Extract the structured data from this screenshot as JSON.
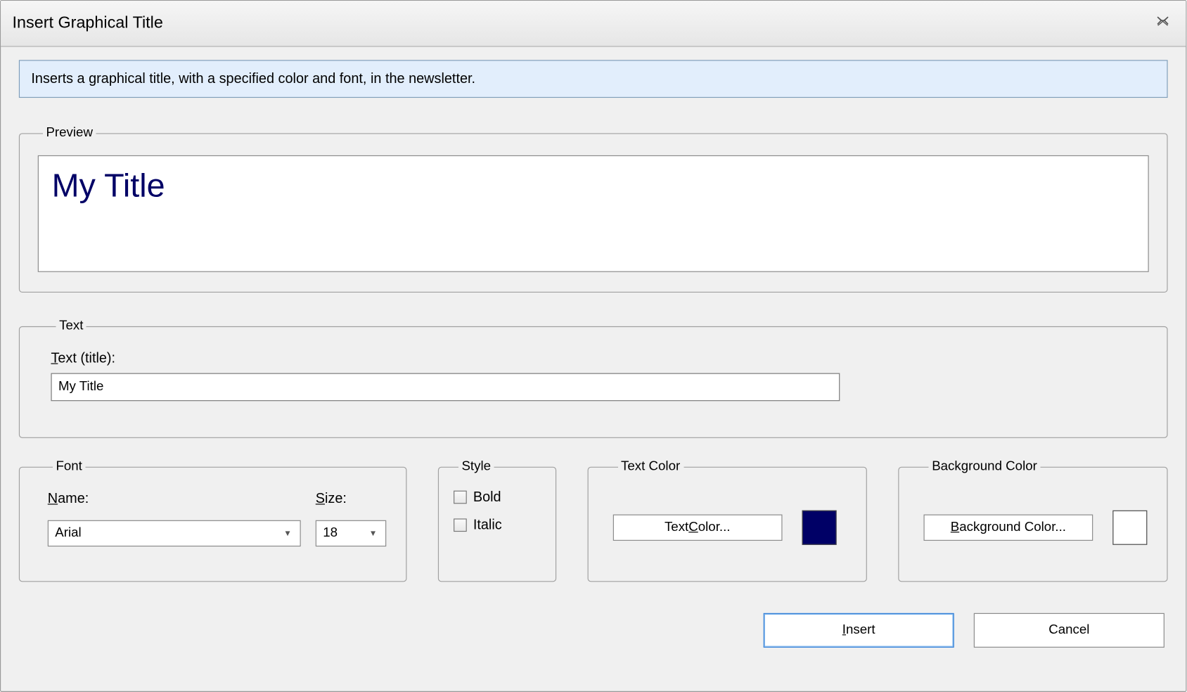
{
  "window": {
    "title": "Insert Graphical Title"
  },
  "description": "Inserts a graphical title, with a specified color and font, in the newsletter.",
  "groups": {
    "preview": "Preview",
    "text": "Text",
    "font": "Font",
    "style": "Style",
    "text_color": "Text Color",
    "background_color": "Background Color"
  },
  "preview": {
    "title_text": "My Title",
    "text_color": "#000066",
    "background_color": "#ffffff",
    "font_family": "Arial"
  },
  "text": {
    "label_prefix": "T",
    "label_rest": "ext (title):",
    "value": "My Title"
  },
  "font": {
    "name_label_prefix": "N",
    "name_label_rest": "ame:",
    "name_value": "Arial",
    "size_label_prefix": "S",
    "size_label_rest": "ize:",
    "size_value": "18"
  },
  "style": {
    "bold_label": "Bold",
    "bold_checked": false,
    "italic_label": "Italic",
    "italic_checked": false
  },
  "text_color_btn": {
    "prefix": "Text ",
    "accel": "C",
    "suffix": "olor...",
    "swatch": "#000066"
  },
  "bg_color_btn": {
    "prefix": "",
    "accel": "B",
    "suffix": "ackground Color...",
    "swatch": "#ffffff"
  },
  "footer": {
    "insert_prefix": "",
    "insert_accel": "I",
    "insert_suffix": "nsert",
    "cancel": "Cancel"
  }
}
